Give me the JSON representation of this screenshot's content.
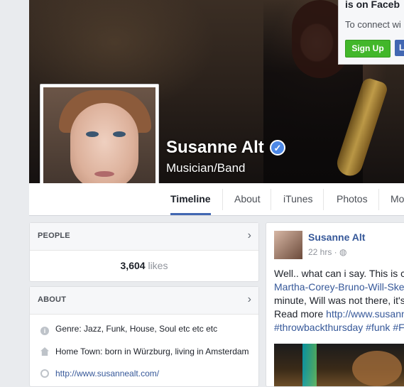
{
  "cover": {
    "popup": {
      "title": "is on Faceb",
      "text": "To connect wi",
      "signup_label": "Sign Up",
      "login_label": "L"
    }
  },
  "profile": {
    "name": "Susanne Alt",
    "verified_icon": "checkmark-icon",
    "category": "Musician/Band"
  },
  "tabs": [
    {
      "label": "Timeline",
      "active": true
    },
    {
      "label": "About"
    },
    {
      "label": "iTunes"
    },
    {
      "label": "Photos"
    },
    {
      "label": "Mo"
    }
  ],
  "people": {
    "title": "PEOPLE",
    "likes_count": "3,604",
    "likes_label": "likes"
  },
  "about": {
    "title": "ABOUT",
    "genre": "Genre: Jazz, Funk, House, Soul etc etc etc",
    "hometown": "Home Town: born in Würzburg, living in Amsterdam",
    "website": "http://www.susannealt.com/"
  },
  "post": {
    "author": "Susanne Alt",
    "time": "22 hrs · ",
    "lines": [
      "Well.. what can i say. This is c",
      "Martha-Corey-Bruno-Will-Ske",
      "minute, Will was not there, it's",
      "Read more ",
      "#throwbackthursday #funk #F"
    ],
    "read_more_link": "http://www.susann"
  }
}
